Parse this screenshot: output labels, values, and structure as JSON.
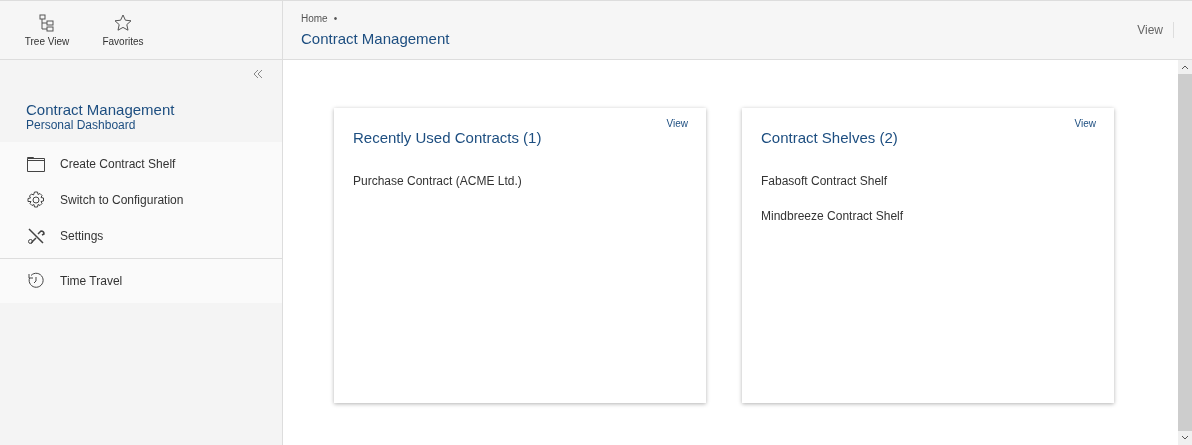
{
  "toolbar": [
    {
      "label": "Tree View",
      "kind": "tree"
    },
    {
      "label": "Favorites",
      "kind": "star"
    }
  ],
  "sidebar": {
    "title": "Contract Management",
    "subtitle": "Personal Dashboard",
    "sections": [
      [
        {
          "label": "Create Contract Shelf",
          "kind": "folder"
        },
        {
          "label": "Switch to Configuration",
          "kind": "gear"
        },
        {
          "label": "Settings",
          "kind": "tools"
        }
      ],
      [
        {
          "label": "Time Travel",
          "kind": "clock"
        }
      ]
    ]
  },
  "header": {
    "breadcrumb": "Home",
    "bullet": "•",
    "title": "Contract Management",
    "action": "View"
  },
  "cards": [
    {
      "title": "Recently Used Contracts (1)",
      "action": "View",
      "items": [
        "Purchase Contract (ACME Ltd.)"
      ]
    },
    {
      "title": "Contract Shelves (2)",
      "action": "View",
      "items": [
        "Fabasoft Contract Shelf",
        "Mindbreeze Contract Shelf"
      ]
    }
  ]
}
